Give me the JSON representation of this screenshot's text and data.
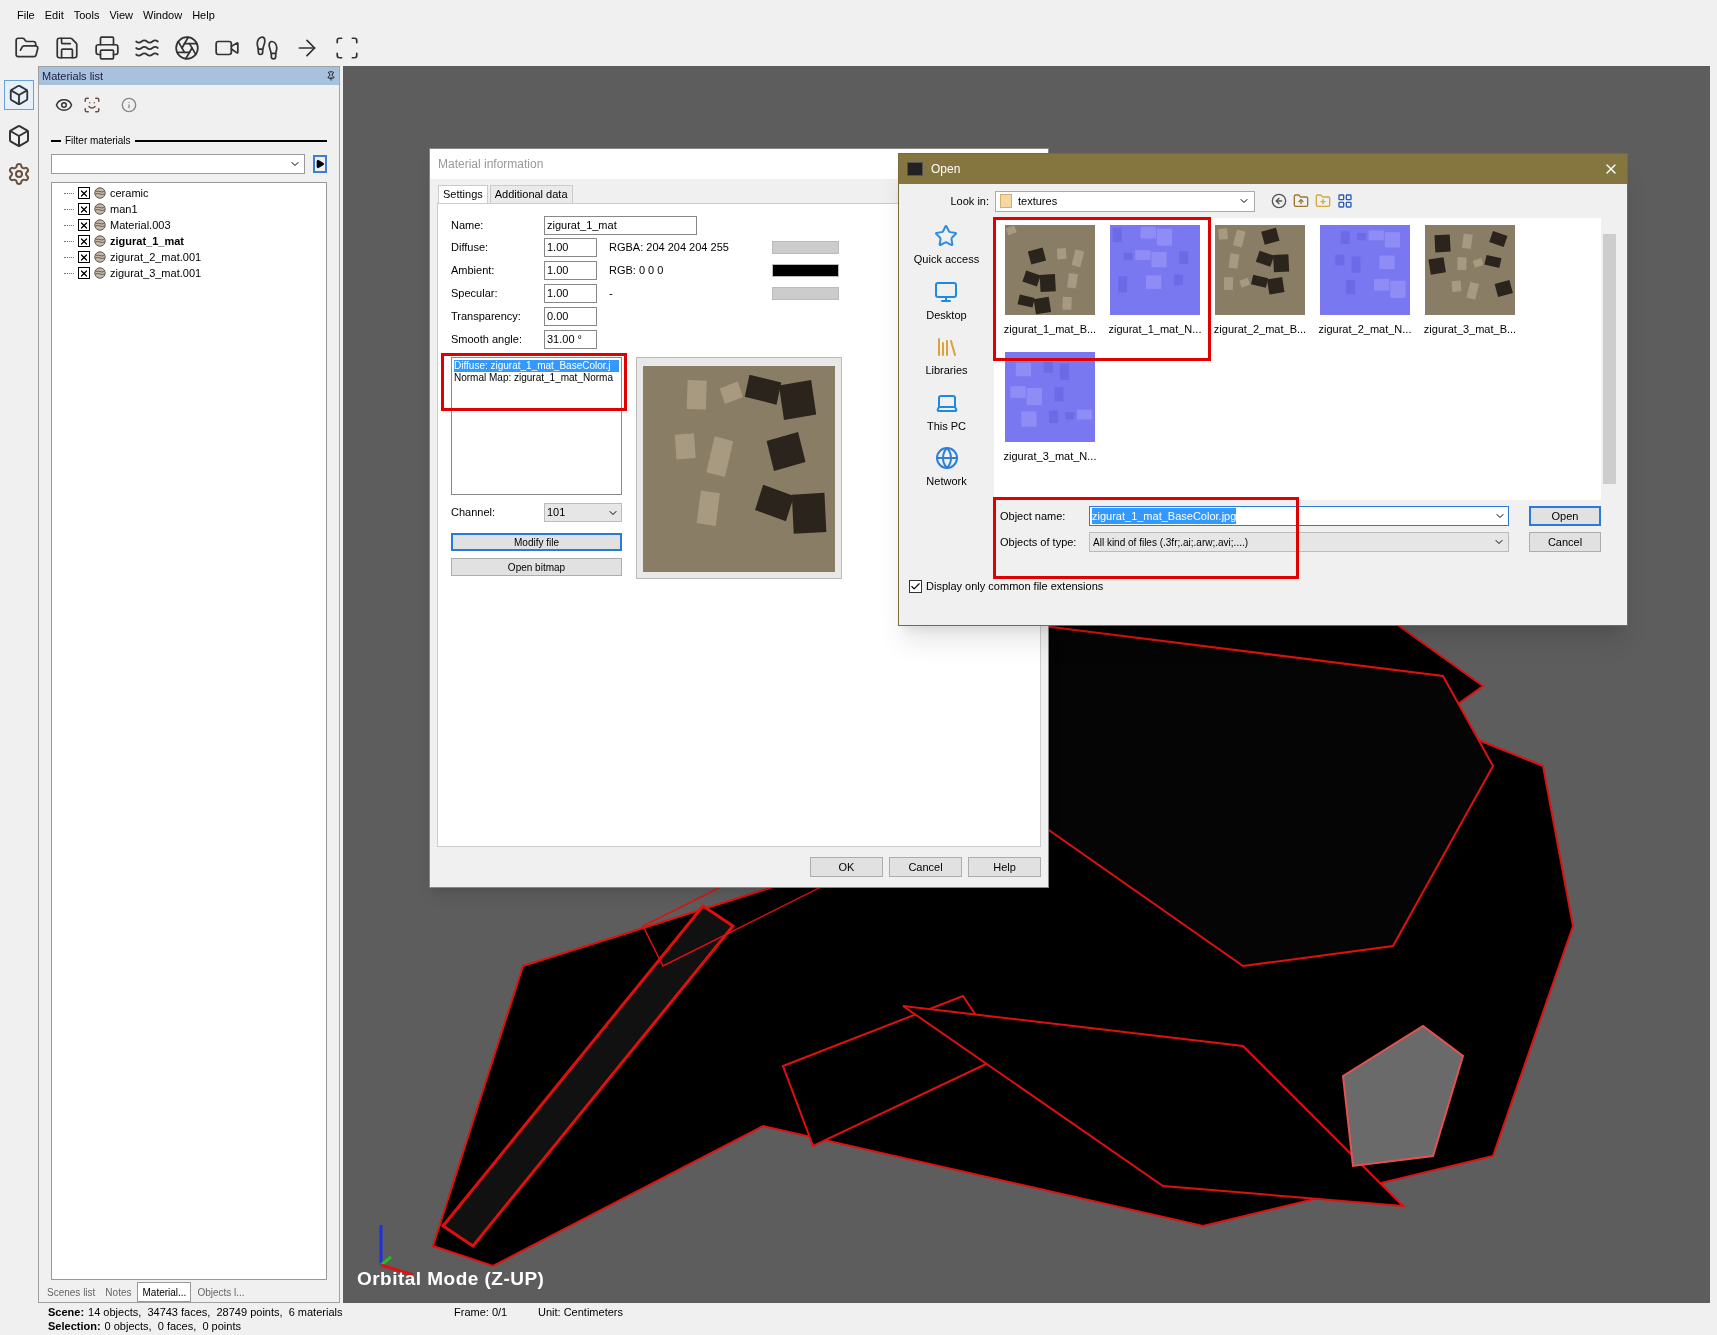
{
  "menu": [
    "File",
    "Edit",
    "Tools",
    "View",
    "Window",
    "Help"
  ],
  "materials_panel": {
    "title": "Materials list",
    "filter_label": "Filter materials",
    "items": [
      {
        "name": "ceramic",
        "checked": true,
        "selected": false
      },
      {
        "name": "man1",
        "checked": true,
        "selected": false
      },
      {
        "name": "Material.003",
        "checked": true,
        "selected": false
      },
      {
        "name": "zigurat_1_mat",
        "checked": true,
        "selected": true
      },
      {
        "name": "zigurat_2_mat.001",
        "checked": true,
        "selected": false
      },
      {
        "name": "zigurat_3_mat.001",
        "checked": true,
        "selected": false
      }
    ]
  },
  "panel_tabs": [
    {
      "label": "Scenes list",
      "selected": false
    },
    {
      "label": "Notes",
      "selected": false
    },
    {
      "label": "Material...",
      "selected": true
    },
    {
      "label": "Objects l...",
      "selected": false
    }
  ],
  "viewport": {
    "mode": "Orbital Mode (Z-UP)"
  },
  "material_dialog": {
    "title": "Material information",
    "tabs": [
      {
        "label": "Settings",
        "selected": true
      },
      {
        "label": "Additional data",
        "selected": false
      }
    ],
    "name_label": "Name:",
    "name": "zigurat_1_mat",
    "properties": [
      {
        "label": "Diffuse:",
        "value": "1.00",
        "info": "RGBA: 204 204 204 255",
        "color": "#cccccc"
      },
      {
        "label": "Ambient:",
        "value": "1.00",
        "info": "RGB: 0 0 0",
        "color": "#000000"
      },
      {
        "label": "Specular:",
        "value": "1.00",
        "info": "-",
        "color": "#cccccc"
      },
      {
        "label": "Transparency:",
        "value": "0.00"
      },
      {
        "label": "Smooth angle:",
        "value": "31.00 °"
      }
    ],
    "maps": [
      {
        "text": "Diffuse: zigurat_1_mat_BaseColor.j",
        "selected": true
      },
      {
        "text": "Normal Map: zigurat_1_mat_Norma",
        "selected": false
      }
    ],
    "channel_label": "Channel:",
    "channel": "101",
    "buttons": [
      "Modify file",
      "Open bitmap"
    ],
    "footer_buttons": [
      "OK",
      "Cancel",
      "Help"
    ]
  },
  "open_dialog": {
    "title": "Open",
    "look_in_label": "Look in:",
    "look_in": "textures",
    "places": [
      "Quick access",
      "Desktop",
      "Libraries",
      "This PC",
      "Network"
    ],
    "files": [
      {
        "name": "zigurat_1_mat_B...",
        "kind": "base"
      },
      {
        "name": "zigurat_1_mat_N...",
        "kind": "normal"
      },
      {
        "name": "zigurat_2_mat_B...",
        "kind": "base"
      },
      {
        "name": "zigurat_2_mat_N...",
        "kind": "normal"
      },
      {
        "name": "zigurat_3_mat_B...",
        "kind": "base"
      },
      {
        "name": "zigurat_3_mat_N...",
        "kind": "normal"
      }
    ],
    "object_name_label": "Object name:",
    "object_name": "zigurat_1_mat_BaseColor.jpg",
    "type_label": "Objects of type:",
    "type": "All kind of files (.3fr;.ai;.arw;.avi;....)",
    "buttons": [
      "Open",
      "Cancel"
    ],
    "common_ext": {
      "label": "Display only common file extensions",
      "checked": true
    }
  },
  "status_bar": {
    "scene_label": "Scene:",
    "scene": "14 objects,  34743 faces,  28749 points,  6 materials",
    "selection_label": "Selection:",
    "selection": "0 objects,  0 faces,  0 points",
    "frame": "Frame: 0/1",
    "unit": "Unit: Centimeters"
  }
}
